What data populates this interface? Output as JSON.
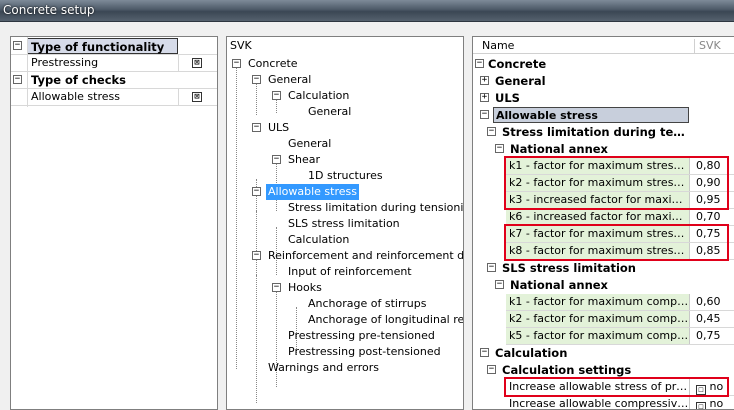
{
  "window": {
    "title": "Concrete setup"
  },
  "left_panel": {
    "rows": [
      {
        "label": "Type of functionality",
        "kind": "category",
        "expander": "−"
      },
      {
        "label": "Prestressing",
        "kind": "item",
        "checked": "⊠"
      },
      {
        "label": "Type of checks",
        "kind": "category",
        "expander": "−"
      },
      {
        "label": "Allowable stress",
        "kind": "item",
        "checked": "⊠"
      }
    ]
  },
  "tree": {
    "header": "SVK",
    "nodes": [
      {
        "label": "Concrete",
        "expander": "−"
      },
      {
        "label": "General",
        "expander": "−"
      },
      {
        "label": "Calculation",
        "expander": "−"
      },
      {
        "label": "General"
      },
      {
        "label": "ULS",
        "expander": "−"
      },
      {
        "label": "General"
      },
      {
        "label": "Shear",
        "expander": "−"
      },
      {
        "label": "1D structures"
      },
      {
        "label": "Allowable stress",
        "expander": "−",
        "selected": true
      },
      {
        "label": "Stress limitation during tensioning"
      },
      {
        "label": "SLS stress limitation"
      },
      {
        "label": "Calculation"
      },
      {
        "label": "Reinforcement and reinforcement design",
        "expander": "−"
      },
      {
        "label": "Input of reinforcement"
      },
      {
        "label": "Hooks",
        "expander": "−"
      },
      {
        "label": "Anchorage of stirrups"
      },
      {
        "label": "Anchorage of longitudinal reinforcement"
      },
      {
        "label": "Prestressing pre-tensioned"
      },
      {
        "label": "Prestressing post-tensioned"
      },
      {
        "label": "Warnings and errors"
      }
    ]
  },
  "grid": {
    "header_name": "Name",
    "header_value": "SVK",
    "rows": [
      {
        "label": "Concrete",
        "expander": "−"
      },
      {
        "label": "General",
        "expander": "+"
      },
      {
        "label": "ULS",
        "expander": "+"
      },
      {
        "label": "Allowable stress",
        "expander": "−"
      },
      {
        "label": "Stress limitation during tensioning",
        "expander": "−"
      },
      {
        "label": "National annex",
        "expander": "−"
      },
      {
        "label": "k1 - factor for maximum stress in prestressing",
        "value": "0,80"
      },
      {
        "label": "k2 - factor for maximum stress in prestressing",
        "value": "0,90"
      },
      {
        "label": "k3 - increased factor for maximum stress",
        "value": "0,95"
      },
      {
        "label": "k6 - increased factor for maximum compressive stress",
        "value": "0,70"
      },
      {
        "label": "k7 - factor for maximum stress in prestressing",
        "value": "0,75"
      },
      {
        "label": "k8 - factor for maximum stress in prestressing",
        "value": "0,85"
      },
      {
        "label": "SLS stress limitation",
        "expander": "−"
      },
      {
        "label": "National annex",
        "expander": "−"
      },
      {
        "label": "k1 - factor for maximum compressive stress",
        "value": "0,60"
      },
      {
        "label": "k2 - factor for maximum compressive stress",
        "value": "0,45"
      },
      {
        "label": "k5 - factor for maximum compressive stress",
        "value": "0,75"
      },
      {
        "label": "Calculation",
        "expander": "−"
      },
      {
        "label": "Calculation settings",
        "expander": "−"
      },
      {
        "label": "Increase allowable stress of prestressing",
        "value": "no",
        "check": "☐"
      },
      {
        "label": "Increase allowable compressive stress",
        "value": "no",
        "check": "☐"
      }
    ]
  },
  "colors": {
    "highlight_border": "#e0001a",
    "selection": "#3399ff",
    "value_cell": "#e3f2d9"
  }
}
